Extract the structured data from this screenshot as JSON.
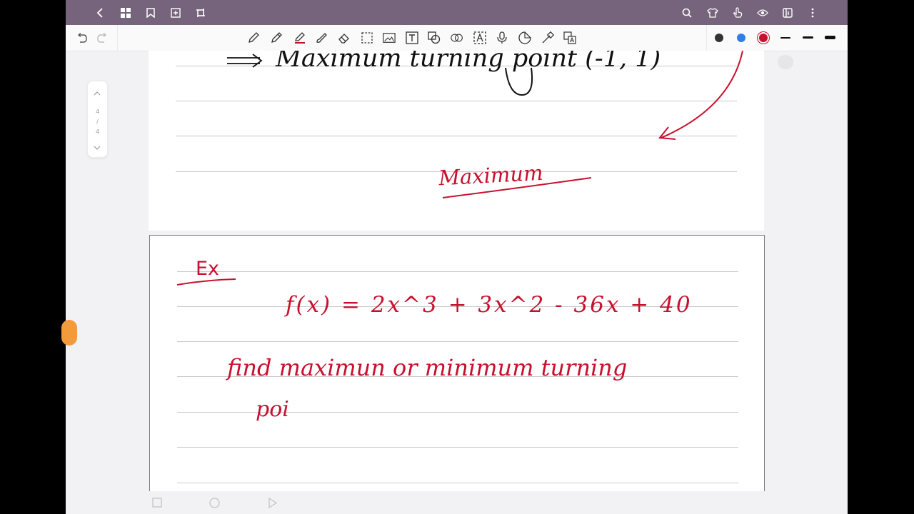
{
  "colors": {
    "header_bg": "#76637c",
    "ink_black": "#111111",
    "ink_red": "#c8102e",
    "ink_blue": "#2f7fea",
    "palette": [
      "#333333",
      "#2f7fea",
      "#c8102e"
    ]
  },
  "header": {
    "left_icons": [
      "back-icon",
      "grid-icon",
      "bookmark-icon",
      "add-page-icon",
      "crop-icon"
    ],
    "right_icons": [
      "search-icon",
      "shirt-icon",
      "hand-pointer-icon",
      "eye-icon",
      "panel-icon",
      "more-icon"
    ]
  },
  "toolbar": {
    "tools": [
      "pencil-icon",
      "pen-icon",
      "highlighter-icon",
      "brush-icon",
      "eraser-icon",
      "lasso-icon",
      "image-icon",
      "text-icon",
      "shapes-icon",
      "link-icon",
      "ocr-icon",
      "mic-icon",
      "sticker-icon",
      "laser-icon",
      "translate-icon"
    ]
  },
  "page_indicator": {
    "current": "4",
    "divider": "/",
    "total": "4"
  },
  "note": {
    "page1": {
      "line1": "Maximum turning point (-1, 1)",
      "label": "Maximum"
    },
    "page2": {
      "tag": "Ex",
      "equation": "f(x) = 2x^3 + 3x^2 - 36x + 40",
      "instruction_line1": "find maximun or minimum turning",
      "instruction_line2": "poi"
    }
  }
}
